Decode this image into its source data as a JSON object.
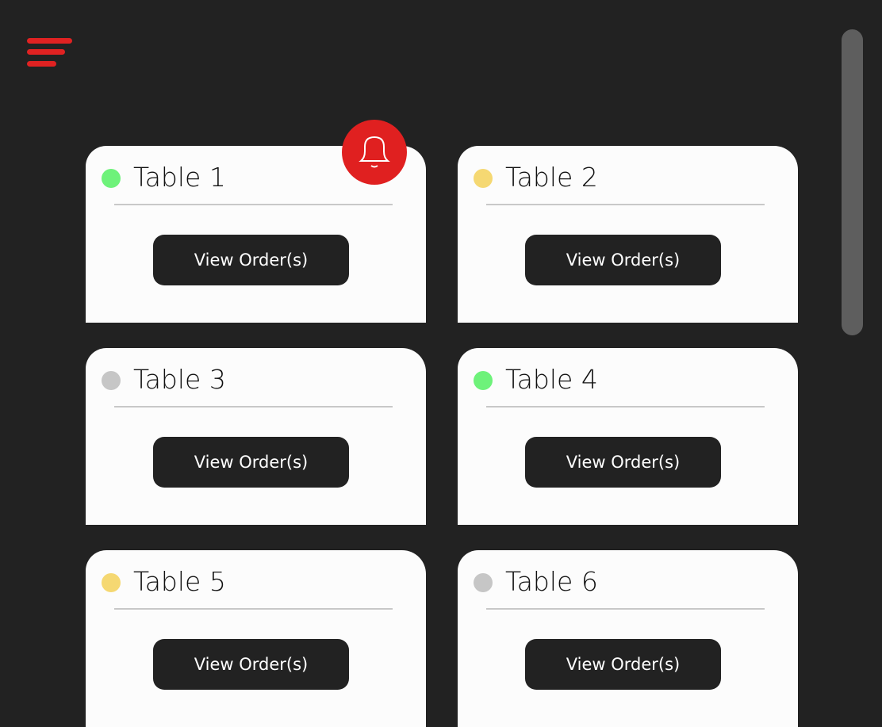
{
  "colors": {
    "accent": "#e02020",
    "green": "#6ef27a",
    "yellow": "#f5d872",
    "grey": "#c6c6c6"
  },
  "tables": [
    {
      "name": "Table 1",
      "status": "green",
      "button": "View Order(s)",
      "alert": true
    },
    {
      "name": "Table 2",
      "status": "yellow",
      "button": "View Order(s)"
    },
    {
      "name": "Table 3",
      "status": "grey",
      "button": "View Order(s)"
    },
    {
      "name": "Table 4",
      "status": "green",
      "button": "View Order(s)"
    },
    {
      "name": "Table 5",
      "status": "yellow",
      "button": "View Order(s)"
    },
    {
      "name": "Table 6",
      "status": "grey",
      "button": "View Order(s)"
    }
  ]
}
